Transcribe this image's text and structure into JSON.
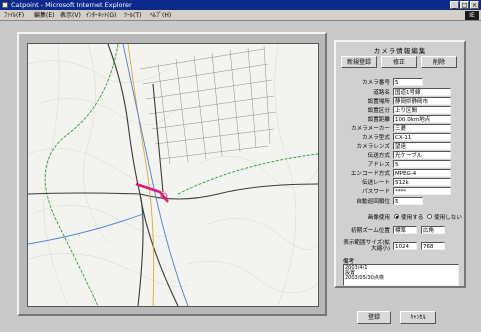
{
  "window": {
    "title": "Catpoint - Microsoft Internet Explorer",
    "controls": [
      "_",
      "□",
      "×"
    ]
  },
  "menu": {
    "items": [
      "ﾌｧｲﾙ(F)",
      "編集(E)",
      "表示(V)",
      "ｲﾝﾀｰﾈｯﾄ(G)",
      "ﾂｰﾙ(T)",
      "ﾍﾙﾌﾟ(H)"
    ],
    "logo": "IE"
  },
  "panel": {
    "title": "カメラ情報編集",
    "buttons": {
      "new": "新規登録",
      "edit": "修正",
      "delete": "削除"
    },
    "fields": [
      {
        "label": "カメラ番号",
        "value": "5"
      },
      {
        "label": "道路名",
        "value": "国道1号線"
      },
      {
        "label": "設置場所",
        "value": "静岡県静岡市"
      },
      {
        "label": "設置区分",
        "value": "上り区間"
      },
      {
        "label": "設置距離",
        "value": "100.0km地点"
      },
      {
        "label": "カメラメーカー",
        "value": "三菱"
      },
      {
        "label": "カメラ型式",
        "value": "CX-11"
      },
      {
        "label": "カメラレンズ",
        "value": "望遠"
      },
      {
        "label": "伝送方式",
        "value": "光ケーブル"
      },
      {
        "label": "アドレス",
        "value": "5"
      },
      {
        "label": "エンコード方式",
        "value": "MPEG-4"
      },
      {
        "label": "伝送レート",
        "value": "512k"
      },
      {
        "label": "パスワード",
        "value": "****"
      },
      {
        "label": "自動巡回順位",
        "value": "5"
      }
    ],
    "usage": {
      "label": "画像使用",
      "on": "使用する",
      "off": "使用しない"
    },
    "preset": {
      "label": "初期ズーム位置",
      "v1": "標準",
      "v2": "広角"
    },
    "display": {
      "label": "表示範囲サイズ(拡大縮小)",
      "v1": "1024",
      "v2": "768"
    },
    "notes": {
      "label": "備考",
      "lines": [
        "2003/4/1",
        "設置",
        "2003/05/30点検"
      ]
    }
  },
  "footer": {
    "ok": "登録",
    "cancel": "ｷｬﾝｾﾙ"
  }
}
